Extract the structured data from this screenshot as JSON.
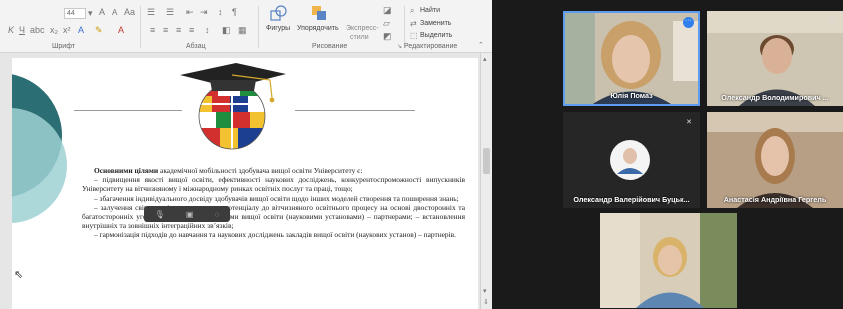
{
  "ribbon": {
    "font_size": "44",
    "groups": {
      "font": "Шрифт",
      "paragraph": "Абзац",
      "drawing": "Рисование",
      "editing": "Редактирование"
    },
    "shapes_label": "Фигуры",
    "arrange_label": "Упорядочить",
    "express_label": "Экспресс-",
    "styles_label": "стили",
    "find_label": "Найти",
    "replace_label": "Заменить",
    "select_label": "Выделить"
  },
  "document": {
    "lead_bold": "Основними цілями",
    "lead_rest": " академічної мобільності здобувача вищої освіти Університету є:",
    "items": [
      "– підвищення якості вищої освіти, ефективності наукових досліджень, конкурентоспроможності випускників Університету на вітчизняному і міжнародному ринках освітніх послуг та праці, тощо;",
      "– збагачення індивідуального досвіду здобувачів вищої освіти щодо інших моделей створення та поширення знань;",
      "– залучення світового інтелектуального потенціалу до вітчизняного освітнього процесу на основі двосторонніх та багатосторонніх угод (договорів) між закладами вищої освіти (науковими установами) – партнерами; – встановлення внутрішніх та зовнішніх інтеграційних зв’язків;",
      "– гармонізація підходів до навчання та наукових досліджень закладів вищої освіти (наукових установ) – партнерів."
    ]
  },
  "participants": [
    {
      "name": "Юлія Помаз",
      "colors": {
        "bg": "#c9c0ad",
        "hair": "#c9a06a",
        "skin": "#e6c5ad",
        "shirt": "#2d3b52"
      }
    },
    {
      "name": "Олександр Володимирович ...",
      "colors": {
        "bg": "#cfc5b3",
        "hair": "#6b4a2f",
        "skin": "#d9b197",
        "shirt": "#3a3f48"
      }
    },
    {
      "name": "Олександр Валерійович Буцьк...",
      "colors": {
        "bg": "#262626"
      }
    },
    {
      "name": "Анастасія Андріївна Гергель",
      "colors": {
        "bg": "#b79f86",
        "hair": "#a77b4e",
        "skin": "#e5c2aa",
        "shirt": "#3b2f2a"
      }
    },
    {
      "name": "",
      "colors": {
        "bg": "#d8cdb9",
        "hair": "#d9b36a",
        "skin": "#e6c4a8",
        "shirt": "#5d86b3"
      }
    }
  ],
  "accent": "#2f80ed"
}
